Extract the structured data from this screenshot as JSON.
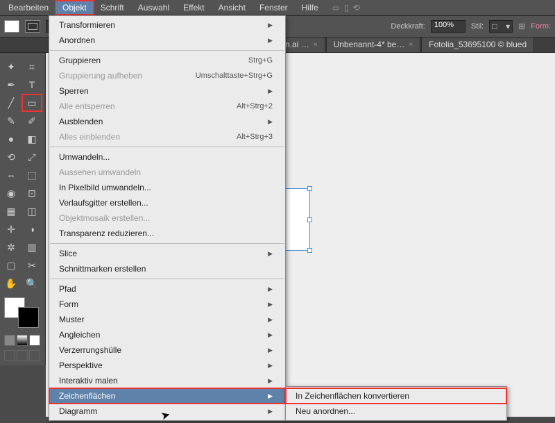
{
  "menubar": {
    "items": [
      "Bearbeiten",
      "Objekt",
      "Schrift",
      "Auswahl",
      "Effekt",
      "Ansicht",
      "Fenster",
      "Hilfe"
    ],
    "active_index": 1
  },
  "options": {
    "opacity_label": "Deckkraft:",
    "opacity_value": "100%",
    "style_label": "Stil:",
    "form_label": "Form:"
  },
  "tabs": [
    {
      "label": "nzparenzen.ai …"
    },
    {
      "label": "Unbenannt-4* be…"
    },
    {
      "label": "Fotolia_53695100 © blued"
    }
  ],
  "menu": {
    "items": [
      {
        "label": "Transformieren",
        "sub": true
      },
      {
        "label": "Anordnen",
        "sub": true
      },
      {
        "sep": true
      },
      {
        "label": "Gruppieren",
        "shortcut": "Strg+G"
      },
      {
        "label": "Gruppierung aufheben",
        "shortcut": "Umschalttaste+Strg+G",
        "disabled": true
      },
      {
        "label": "Sperren",
        "sub": true
      },
      {
        "label": "Alle entsperren",
        "shortcut": "Alt+Strg+2",
        "disabled": true
      },
      {
        "label": "Ausblenden",
        "sub": true
      },
      {
        "label": "Alles einblenden",
        "shortcut": "Alt+Strg+3",
        "disabled": true
      },
      {
        "sep": true
      },
      {
        "label": "Umwandeln..."
      },
      {
        "label": "Aussehen umwandeln",
        "disabled": true
      },
      {
        "label": "In Pixelbild umwandeln..."
      },
      {
        "label": "Verlaufsgitter erstellen..."
      },
      {
        "label": "Objektmosaik erstellen...",
        "disabled": true
      },
      {
        "label": "Transparenz reduzieren..."
      },
      {
        "sep": true
      },
      {
        "label": "Slice",
        "sub": true
      },
      {
        "label": "Schnittmarken erstellen"
      },
      {
        "sep": true
      },
      {
        "label": "Pfad",
        "sub": true
      },
      {
        "label": "Form",
        "sub": true
      },
      {
        "label": "Muster",
        "sub": true
      },
      {
        "label": "Angleichen",
        "sub": true
      },
      {
        "label": "Verzerrungshülle",
        "sub": true
      },
      {
        "label": "Perspektive",
        "sub": true
      },
      {
        "label": "Interaktiv malen",
        "sub": true
      },
      {
        "label": "Zeichenflächen",
        "sub": true,
        "hover": true,
        "sel": true
      },
      {
        "label": "Diagramm",
        "sub": true
      }
    ]
  },
  "submenu": {
    "items": [
      {
        "label": "In Zeichenflächen konvertieren",
        "sel": true
      },
      {
        "label": "Neu anordnen..."
      }
    ]
  }
}
